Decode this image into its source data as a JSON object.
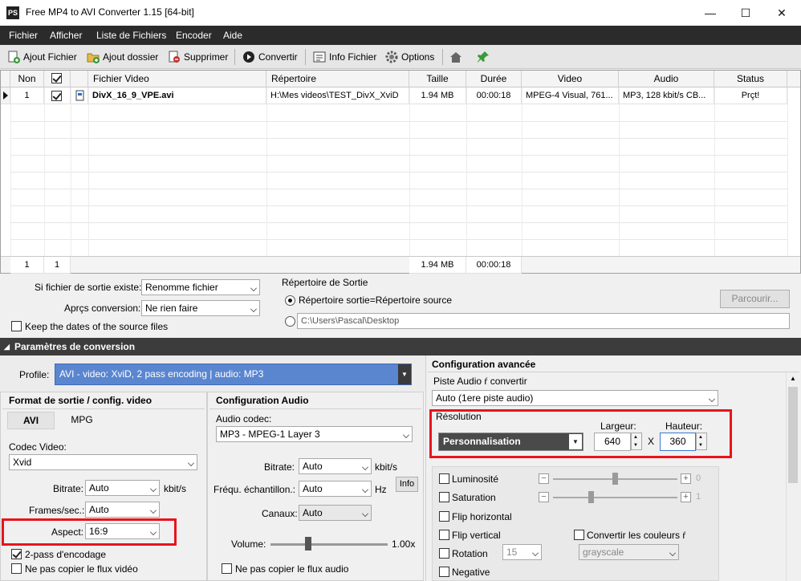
{
  "window": {
    "title": "Free MP4 to AVI Converter 1.15  [64-bit]",
    "icon_text": "PS"
  },
  "menu": [
    "Fichier",
    "Afficher",
    "Liste de Fichiers",
    "Encoder",
    "Aide"
  ],
  "toolbar": {
    "add_file": "Ajout Fichier",
    "add_folder": "Ajout dossier",
    "delete": "Supprimer",
    "convert": "Convertir",
    "info": "Info Fichier",
    "options": "Options"
  },
  "grid": {
    "headers": [
      "Non",
      "",
      "Fichier Video",
      "Répertoire",
      "Taille",
      "Durée",
      "Video",
      "Audio",
      "Status"
    ],
    "rows": [
      {
        "num": "1",
        "checked": true,
        "file": "DivX_16_9_VPE.avi",
        "dir": "H:\\Mes videos\\TEST_DivX_XviD",
        "size": "1.94 MB",
        "duration": "00:00:18",
        "video": "MPEG-4 Visual, 761...",
        "audio": "MP3, 128 kbit/s CB...",
        "status": "Prçt!"
      }
    ],
    "footer": {
      "count": "1",
      "checked": "1",
      "size": "1.94 MB",
      "duration": "00:00:18"
    }
  },
  "output": {
    "exists_label": "Si fichier de sortie existe:",
    "exists_value": "Renomme fichier",
    "after_label": "Aprçs conversion:",
    "after_value": "Ne rien faire",
    "keep_dates": "Keep the dates of the source files",
    "dir_title": "Répertoire de Sortie",
    "dir_option1": "Répertoire sortie=Répertoire source",
    "dir_path": "C:\\Users\\Pascal\\Desktop",
    "browse": "Parcourir..."
  },
  "conversion": {
    "header": "Paramètres de conversion",
    "profile_label": "Profile:",
    "profile_value": "AVI - video: XviD, 2 pass encoding | audio: MP3"
  },
  "video": {
    "title": "Format de sortie / config. video",
    "tabs": [
      "AVI",
      "MPG"
    ],
    "codec_label": "Codec Video:",
    "codec_value": "Xvid",
    "bitrate_label": "Bitrate:",
    "bitrate_value": "Auto",
    "bitrate_unit": "kbit/s",
    "fps_label": "Frames/sec.:",
    "fps_value": "Auto",
    "aspect_label": "Aspect:",
    "aspect_value": "16:9",
    "twopass": "2-pass d'encodage",
    "nocopy": "Ne pas copier le flux vidéo"
  },
  "audio": {
    "title": "Configuration Audio",
    "codec_label": "Audio codec:",
    "codec_value": "MP3 - MPEG-1 Layer 3",
    "bitrate_label": "Bitrate:",
    "bitrate_value": "Auto",
    "bitrate_unit": "kbit/s",
    "freq_label": "Fréqu. échantillon.:",
    "freq_value": "Auto",
    "freq_unit": "Hz",
    "info": "Info",
    "channels_label": "Canaux:",
    "channels_value": "Auto",
    "volume_label": "Volume:",
    "volume_value": "1.00x",
    "nocopy": "Ne pas copier le flux audio"
  },
  "advanced": {
    "title": "Configuration avancée",
    "track_label": "Piste Audio ŕ convertir",
    "track_value": "Auto (1ere piste audio)",
    "resolution_label": "Résolution",
    "resolution_value": "Personnalisation",
    "width_label": "Largeur:",
    "width_value": "640",
    "height_label": "Hauteur:",
    "height_value": "360",
    "x": "X",
    "brightness": "Luminosité",
    "brightness_value": "0",
    "saturation": "Saturation",
    "saturation_value": "1",
    "hflip": "Flip horizontal",
    "vflip": "Flip vertical",
    "rotation": "Rotation",
    "rotation_value": "15",
    "convert_colors": "Convertir les couleurs ŕ",
    "colors_value": "grayscale",
    "negative": "Negative"
  }
}
